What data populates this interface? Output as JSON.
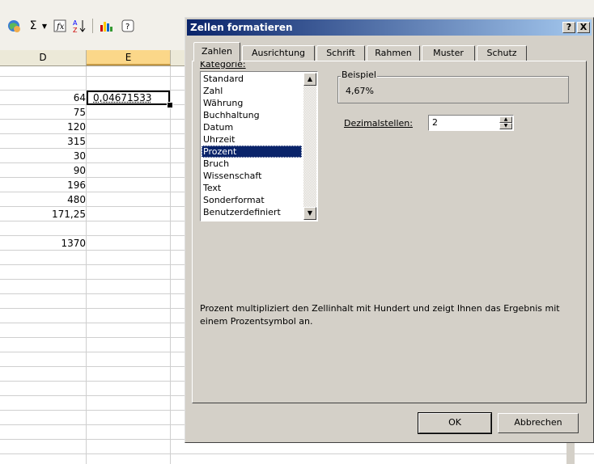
{
  "toolbar": {
    "icons": [
      "web-icon",
      "sum-icon",
      "dropdown-arrow-icon",
      "insert-function-icon",
      "sort-ascending-icon",
      "chart-wizard-icon",
      "help-icon"
    ],
    "sum_symbol": "Σ",
    "sort_label": "A\nZ",
    "help_symbol": "?"
  },
  "sheet": {
    "columns": [
      "D",
      "E"
    ],
    "selected_column": "E",
    "column_d_values": [
      "64",
      "75",
      "120",
      "315",
      "30",
      "90",
      "196",
      "480",
      "171,25",
      "",
      "1370"
    ],
    "active_cell_value": "0,04671533"
  },
  "dialog": {
    "title": "Zellen formatieren",
    "help_button": "?",
    "close_button": "X",
    "tabs": [
      "Zahlen",
      "Ausrichtung",
      "Schrift",
      "Rahmen",
      "Muster",
      "Schutz"
    ],
    "active_tab": "Zahlen",
    "category_label": "Kategorie:",
    "categories": [
      "Standard",
      "Zahl",
      "Währung",
      "Buchhaltung",
      "Datum",
      "Uhrzeit",
      "Prozent",
      "Bruch",
      "Wissenschaft",
      "Text",
      "Sonderformat",
      "Benutzerdefiniert"
    ],
    "selected_category": "Prozent",
    "sample_label": "Beispiel",
    "sample_value": "4,67%",
    "decimals_label": "Dezimalstellen:",
    "decimals_value": "2",
    "description": "Prozent multipliziert den Zellinhalt mit Hundert und zeigt Ihnen das Ergebnis mit einem Prozentsymbol an.",
    "ok_label": "OK",
    "cancel_label": "Abbrechen"
  },
  "colors": {
    "title_gradient_start": "#0a246a",
    "title_gradient_end": "#a6caf0",
    "dialog_face": "#d4d0c8",
    "selection": "#0a246a",
    "selected_column_header": "#fbd789"
  }
}
